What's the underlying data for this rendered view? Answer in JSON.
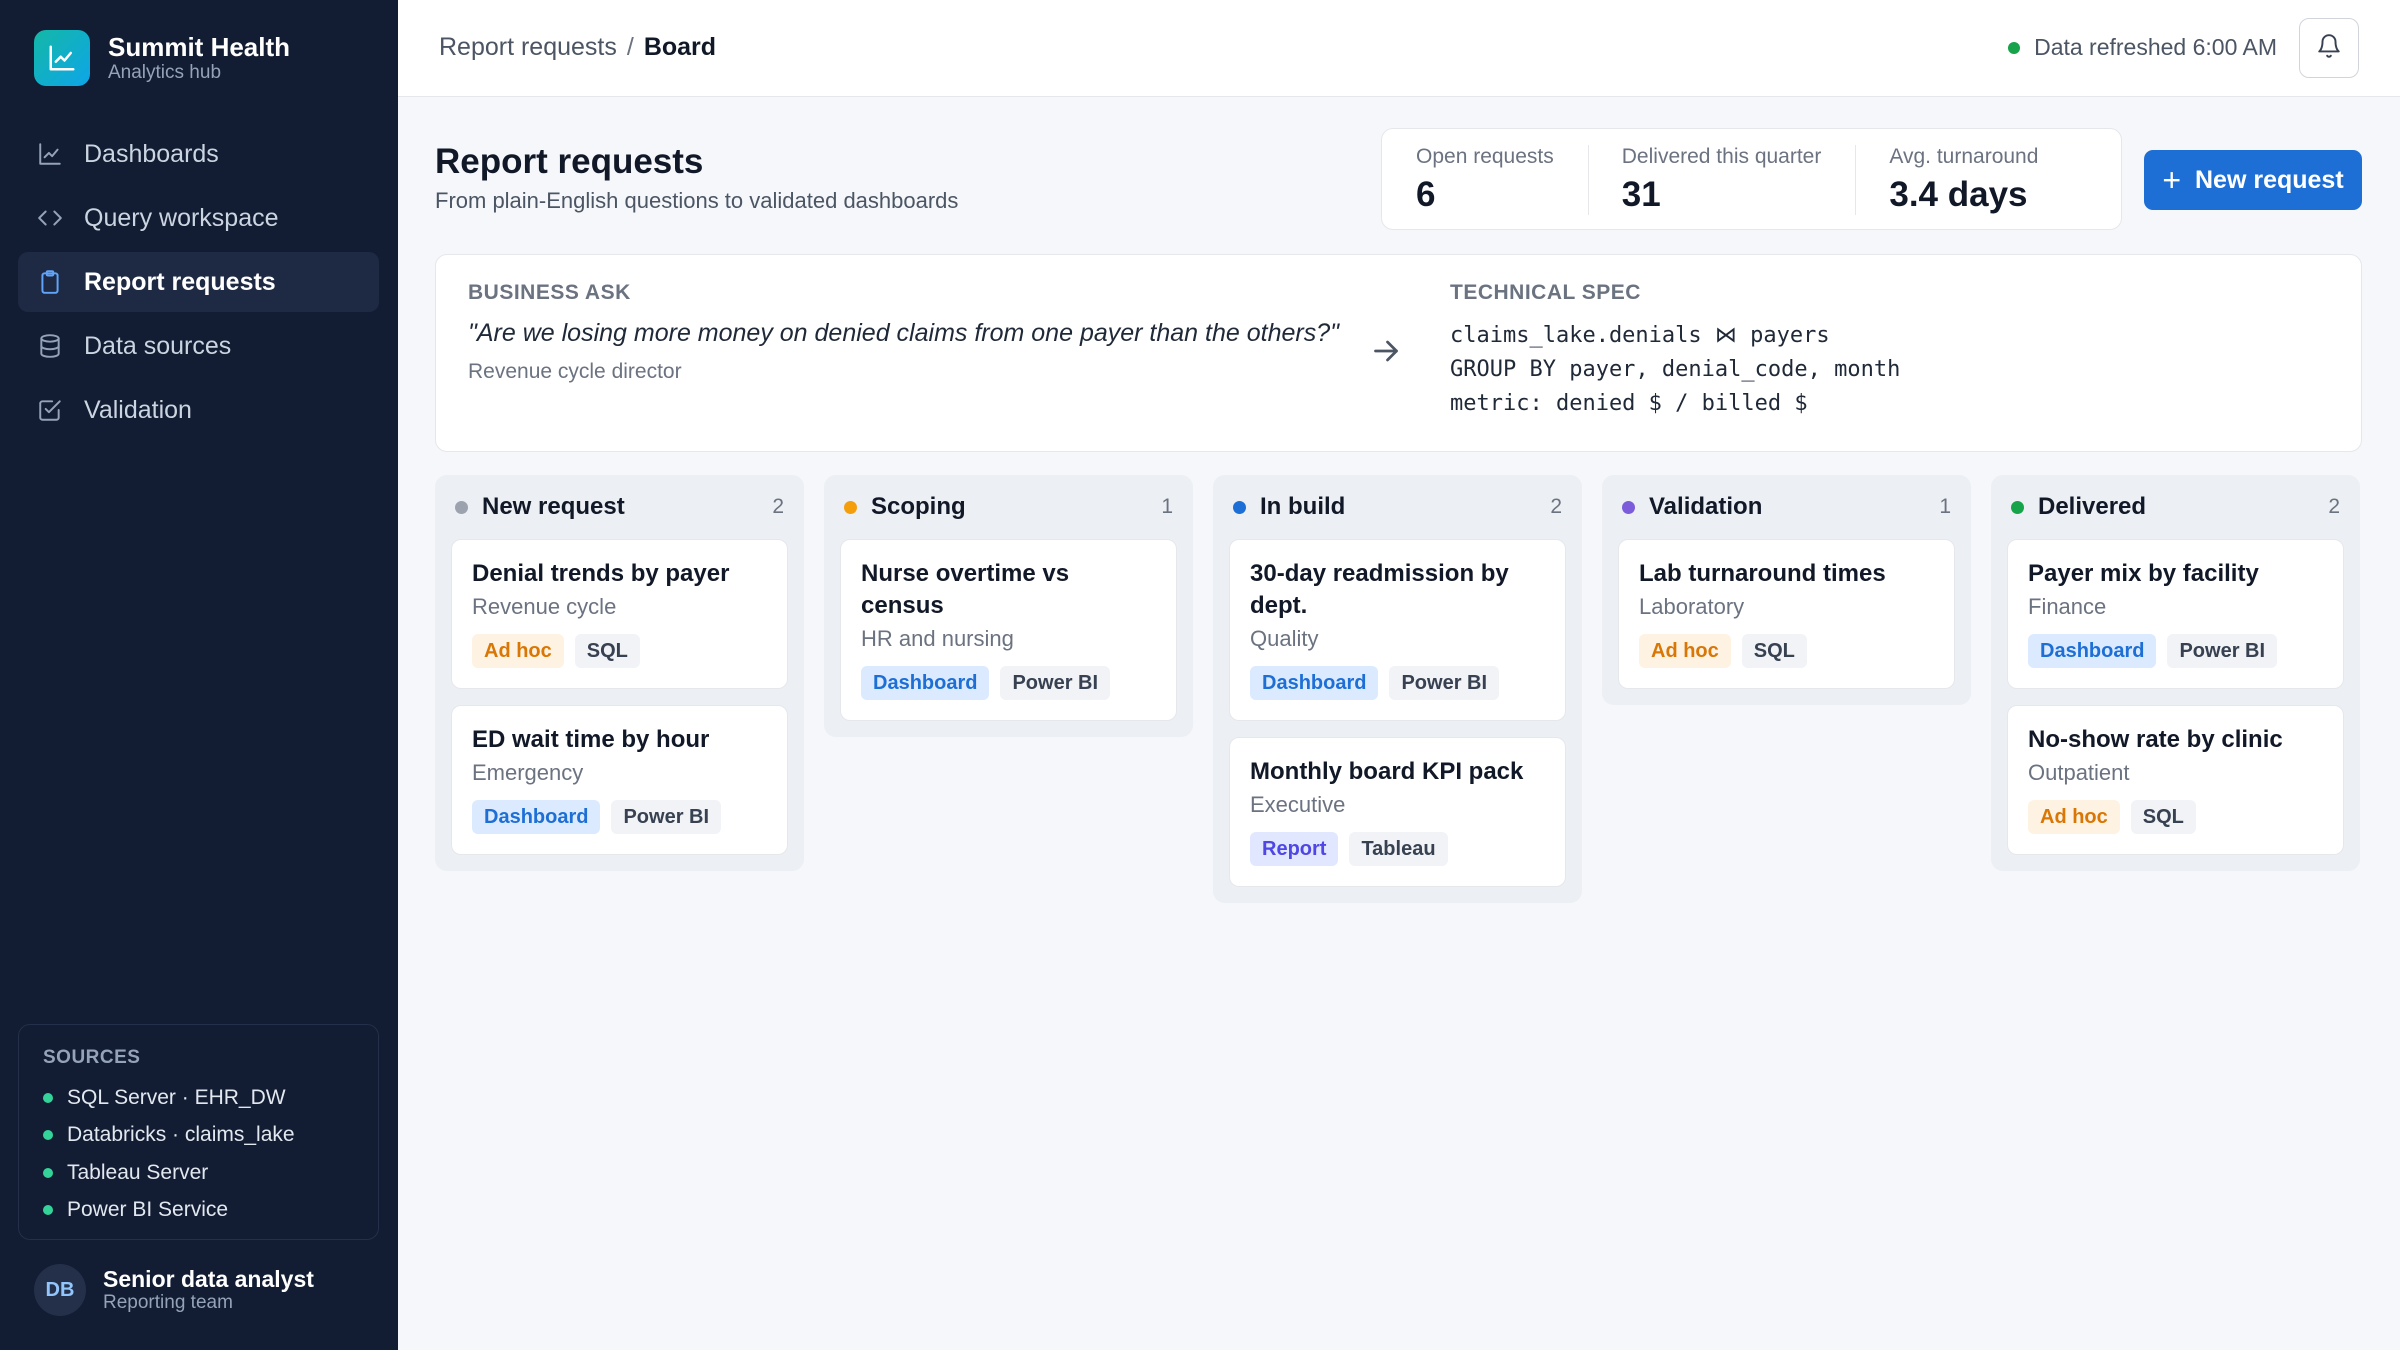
{
  "brand": {
    "name": "Summit Health",
    "subtitle": "Analytics hub",
    "icon": "line-chart-icon"
  },
  "nav": [
    {
      "label": "Dashboards",
      "icon": "line-chart-icon",
      "active": false
    },
    {
      "label": "Query workspace",
      "icon": "code-icon",
      "active": false
    },
    {
      "label": "Report requests",
      "icon": "clipboard-icon",
      "active": true
    },
    {
      "label": "Data sources",
      "icon": "database-icon",
      "active": false
    },
    {
      "label": "Validation",
      "icon": "check-square-icon",
      "active": false
    }
  ],
  "sources": {
    "title": "SOURCES",
    "items": [
      "SQL Server · EHR_DW",
      "Databricks · claims_lake",
      "Tableau Server",
      "Power BI Service"
    ],
    "status_color": "#34d399"
  },
  "user": {
    "initials": "DB",
    "name": "Senior data analyst",
    "team": "Reporting team"
  },
  "topbar": {
    "breadcrumb_parent": "Report requests",
    "breadcrumb_sep": "/",
    "breadcrumb_current": "Board",
    "refresh_text": "Data refreshed 6:00 AM",
    "bell_icon": "bell-icon"
  },
  "header": {
    "title": "Report requests",
    "subtitle": "From plain-English questions to validated dashboards"
  },
  "stats": [
    {
      "label": "Open requests",
      "value": "6"
    },
    {
      "label": "Delivered this quarter",
      "value": "31"
    },
    {
      "label": "Avg. turnaround",
      "value": "3.4 days"
    }
  ],
  "new_button": {
    "label": "New request",
    "icon": "plus-icon"
  },
  "translation": {
    "ask_label": "BUSINESS ASK",
    "ask_quote": "\"Are we losing more money on denied claims from one payer than the others?\"",
    "ask_who": "Revenue cycle director",
    "spec_label": "TECHNICAL SPEC",
    "spec_lines": [
      "claims_lake.denials ⋈ payers",
      "GROUP BY payer, denial_code, month",
      "metric: denied $ / billed $"
    ]
  },
  "columns": [
    {
      "title": "New request",
      "count": "2",
      "color": "#9ca3af",
      "cards": [
        {
          "title": "Denial trends by payer",
          "dept": "Revenue cycle",
          "type": "Ad hoc",
          "type_kind": "adhoc",
          "tool": "SQL"
        },
        {
          "title": "ED wait time by hour",
          "dept": "Emergency",
          "type": "Dashboard",
          "type_kind": "dashboard",
          "tool": "Power BI"
        }
      ]
    },
    {
      "title": "Scoping",
      "count": "1",
      "color": "#f59e0b",
      "cards": [
        {
          "title": "Nurse overtime vs census",
          "dept": "HR and nursing",
          "type": "Dashboard",
          "type_kind": "dashboard",
          "tool": "Power BI"
        }
      ]
    },
    {
      "title": "In build",
      "count": "2",
      "color": "#1d6fd6",
      "cards": [
        {
          "title": "30-day readmission by dept.",
          "dept": "Quality",
          "type": "Dashboard",
          "type_kind": "dashboard",
          "tool": "Power BI"
        },
        {
          "title": "Monthly board KPI pack",
          "dept": "Executive",
          "type": "Report",
          "type_kind": "report",
          "tool": "Tableau"
        }
      ]
    },
    {
      "title": "Validation",
      "count": "1",
      "color": "#7c5cdb",
      "cards": [
        {
          "title": "Lab turnaround times",
          "dept": "Laboratory",
          "type": "Ad hoc",
          "type_kind": "adhoc",
          "tool": "SQL"
        }
      ]
    },
    {
      "title": "Delivered",
      "count": "2",
      "color": "#16a34a",
      "cards": [
        {
          "title": "Payer mix by facility",
          "dept": "Finance",
          "type": "Dashboard",
          "type_kind": "dashboard",
          "tool": "Power BI"
        },
        {
          "title": "No-show rate by clinic",
          "dept": "Outpatient",
          "type": "Ad hoc",
          "type_kind": "adhoc",
          "tool": "SQL"
        }
      ]
    }
  ]
}
